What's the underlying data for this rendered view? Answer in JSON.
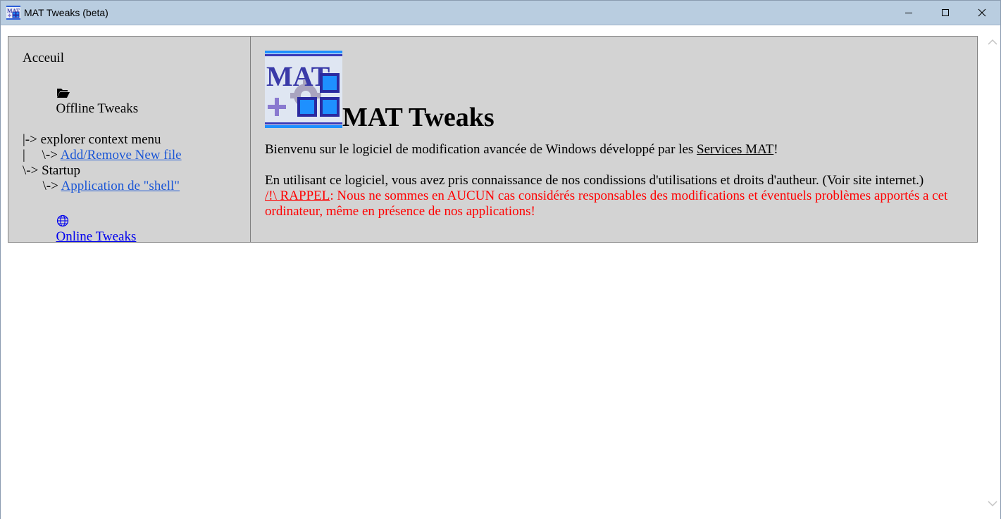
{
  "window": {
    "title": "MAT Tweaks (beta)",
    "controls": [
      "minimize-icon",
      "maximize-icon",
      "close-icon"
    ]
  },
  "sidebar": {
    "home": "Acceuil",
    "offline": "Offline Tweaks",
    "line1_prefix": "|-> ",
    "line1_text": "explorer context menu",
    "line2_prefix": "|     \\-> ",
    "line2_link": "Add/Remove New file",
    "line3_prefix": "\\-> ",
    "line3_text": "Startup",
    "line4_prefix": "      \\-> ",
    "line4_link": "Application de \"shell\"",
    "online": "Online Tweaks"
  },
  "main": {
    "logo_text": "MAT",
    "title": "MAT Tweaks",
    "welcome_before": "Bienvenu sur le logiciel de modification avancée de Windows développé par les ",
    "welcome_link": "Services MAT",
    "welcome_after": "!",
    "terms": "En utilisant ce logiciel, vous avez pris connaissance de nos condissions d'utilisations et droits d'autheur. (Voir site internet.)",
    "warning_link": "/!\\ RAPPEL",
    "warning_text": ": Nous ne sommes en AUCUN cas considérés responsables des modifications et éventuels problèmes apportés a cet ordinateur, même en présence de nos applications!"
  },
  "colors": {
    "titlebar": "#b9cde0",
    "panel": "#d3d3d3",
    "link": "#1a56d6",
    "warning": "#ff0000"
  }
}
